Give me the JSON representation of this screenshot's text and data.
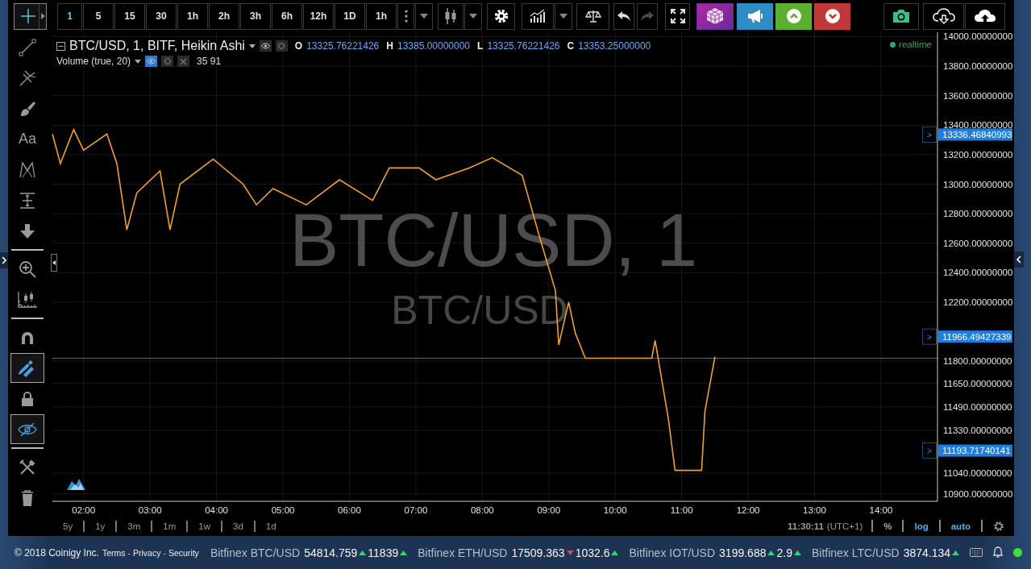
{
  "toolbar": {
    "crosshair": {
      "selected": true
    },
    "intervals": [
      {
        "label": "1",
        "selected": true
      },
      {
        "label": "5",
        "selected": false
      },
      {
        "label": "15",
        "selected": false
      },
      {
        "label": "30",
        "selected": false
      },
      {
        "label": "1h",
        "selected": false
      },
      {
        "label": "2h",
        "selected": false
      },
      {
        "label": "3h",
        "selected": false
      },
      {
        "label": "6h",
        "selected": false
      },
      {
        "label": "12h",
        "selected": false
      },
      {
        "label": "1D",
        "selected": false
      },
      {
        "label": "1h",
        "selected": false
      }
    ],
    "tools": [
      {
        "kind": "more",
        "disabled": false
      },
      {
        "kind": "caret",
        "disabled": false
      },
      {
        "kind": "candles",
        "disabled": false
      },
      {
        "kind": "caret",
        "disabled": false
      },
      {
        "kind": "settings",
        "disabled": false
      },
      {
        "kind": "indicators",
        "disabled": false
      },
      {
        "kind": "caret",
        "disabled": false
      },
      {
        "kind": "compare",
        "disabled": false
      },
      {
        "kind": "undo",
        "disabled": false
      },
      {
        "kind": "redo",
        "disabled": true
      },
      {
        "kind": "fullscreen",
        "disabled": false
      },
      {
        "kind": "cube",
        "disabled": false
      },
      {
        "kind": "announce",
        "disabled": false
      },
      {
        "kind": "buy",
        "disabled": false
      },
      {
        "kind": "sell",
        "disabled": false
      },
      {
        "kind": "snapshot",
        "disabled": false
      },
      {
        "kind": "load",
        "disabled": false
      },
      {
        "kind": "save",
        "disabled": false
      }
    ]
  },
  "sidebar": {
    "groups": [
      {
        "items": [
          {
            "kind": "line",
            "on": false
          },
          {
            "kind": "pitchfork",
            "on": false
          },
          {
            "kind": "brush",
            "on": false
          },
          {
            "kind": "text",
            "label": "Aa",
            "on": false
          },
          {
            "kind": "pattern",
            "on": false
          },
          {
            "kind": "measure",
            "on": false
          },
          {
            "kind": "arrow",
            "on": false
          }
        ]
      },
      {
        "items": [
          {
            "kind": "zoom",
            "on": false
          },
          {
            "kind": "ruler",
            "on": false
          }
        ]
      },
      {
        "items": [
          {
            "kind": "magnet",
            "on": false
          },
          {
            "kind": "stay-drawing",
            "on": true
          },
          {
            "kind": "lock",
            "on": false
          },
          {
            "kind": "hide",
            "on": true
          }
        ]
      },
      {
        "items": [
          {
            "kind": "tools",
            "on": false
          },
          {
            "kind": "trash",
            "on": false
          }
        ]
      }
    ]
  },
  "legend": {
    "rows": [
      {
        "kind": "series",
        "title": "BTC/USD, 1, BITF, Heikin Ashi",
        "eye_on": false,
        "values": [
          {
            "label": "O",
            "value": "13325.76221426"
          },
          {
            "label": "H",
            "value": "13385.00000000"
          },
          {
            "label": "L",
            "value": "13325.76221426"
          },
          {
            "label": "C",
            "value": "13353.25000000"
          }
        ]
      },
      {
        "kind": "indicator",
        "title": "Volume (true, 20)",
        "eye_on": true,
        "text": "35 91"
      }
    ],
    "realtime": {
      "label": "realtime",
      "live": true
    }
  },
  "chart": {
    "watermark": {
      "title": "BTC/USD, 1",
      "subtitle": "BTC/USD"
    },
    "price_badges": [
      {
        "marker": ">",
        "value": "13336.46840993"
      },
      {
        "marker": ">",
        "value": "11966.49427339"
      },
      {
        "marker": ">",
        "value": "11193.71740141"
      }
    ],
    "chart_data": {
      "type": "line",
      "xlim": [
        1.53,
        14.85
      ],
      "ylim": [
        10850,
        14030
      ],
      "x": [
        1.53,
        1.65,
        1.85,
        2.0,
        2.35,
        2.5,
        2.65,
        2.8,
        3.15,
        3.3,
        3.45,
        3.95,
        4.4,
        4.6,
        4.85,
        5.35,
        5.85,
        6.35,
        6.6,
        7.05,
        7.3,
        7.8,
        8.15,
        8.6,
        8.85,
        9.1,
        9.15,
        9.3,
        9.4,
        9.55,
        10.55,
        10.6,
        10.8,
        10.9,
        11.3,
        11.35,
        11.5
      ],
      "series": [
        {
          "color": "#f0a030",
          "values": [
            13340,
            13140,
            13370,
            13230,
            13340,
            13140,
            12690,
            12940,
            13090,
            12690,
            13000,
            13170,
            13000,
            12860,
            12970,
            12860,
            13030,
            12890,
            13110,
            13110,
            13030,
            13110,
            13180,
            13060,
            12660,
            12280,
            11910,
            12200,
            11990,
            11820,
            11820,
            11940,
            11410,
            11060,
            11060,
            11460,
            11830
          ]
        }
      ],
      "xticks": [
        {
          "value": 2,
          "label": "02:00"
        },
        {
          "value": 3,
          "label": "03:00"
        },
        {
          "value": 4,
          "label": "04:00"
        },
        {
          "value": 5,
          "label": "05:00"
        },
        {
          "value": 6,
          "label": "06:00"
        },
        {
          "value": 7,
          "label": "07:00"
        },
        {
          "value": 8,
          "label": "08:00"
        },
        {
          "value": 9,
          "label": "09:00"
        },
        {
          "value": 10,
          "label": "10:00"
        },
        {
          "value": 11,
          "label": "11:00"
        },
        {
          "value": 12,
          "label": "12:00"
        },
        {
          "value": 13,
          "label": "13:00"
        },
        {
          "value": 14,
          "label": "14:00"
        }
      ],
      "yticks": [
        {
          "value": 14000,
          "label": "14000.00000000"
        },
        {
          "value": 13800,
          "label": "13800.00000000"
        },
        {
          "value": 13600,
          "label": "13600.00000000"
        },
        {
          "value": 13400,
          "label": "13400.00000000"
        },
        {
          "value": 13200,
          "label": "13200.00000000"
        },
        {
          "value": 13000,
          "label": "13000.00000000"
        },
        {
          "value": 12800,
          "label": "12800.00000000"
        },
        {
          "value": 12600,
          "label": "12600.00000000"
        },
        {
          "value": 12400,
          "label": "12400.00000000"
        },
        {
          "value": 12200,
          "label": "12200.00000000"
        },
        {
          "value": 11800,
          "label": "11800.00000000"
        },
        {
          "value": 11650,
          "label": "11650.00000000"
        },
        {
          "value": 11490,
          "label": "11490.00000000"
        },
        {
          "value": 11330,
          "label": "11330.00000000"
        },
        {
          "value": 11040,
          "label": "11040.00000000"
        },
        {
          "value": 10900,
          "label": "10900.00000000"
        }
      ],
      "grid": true,
      "ref_lines": [
        {
          "value": 11820,
          "axis": "y"
        }
      ]
    }
  },
  "bottom_bar": {
    "ranges": [
      "5y",
      "1y",
      "3m",
      "1m",
      "1w",
      "3d",
      "1d"
    ],
    "time": "11:30:11",
    "timezone": "(UTC+1)",
    "options": [
      {
        "label": "%",
        "selected": false
      },
      {
        "label": "log",
        "selected": true
      },
      {
        "label": "auto",
        "selected": true
      }
    ]
  },
  "footer": {
    "copyright": "© 2018 Coinigy Inc.",
    "links": [
      {
        "kind": "link",
        "text": "Terms"
      },
      {
        "kind": "separator",
        "text": "-"
      },
      {
        "kind": "link",
        "text": "Privacy"
      },
      {
        "kind": "separator",
        "text": "-"
      },
      {
        "kind": "link",
        "text": "Security"
      }
    ],
    "ticker": [
      {
        "exchange": "Bitfinex",
        "pair": "BTC/USD",
        "price": "54814.759",
        "price_up": true,
        "volume": "11839",
        "volume_up": true
      },
      {
        "exchange": "Bitfinex",
        "pair": "ETH/USD",
        "price": "17509.363",
        "price_up": false,
        "volume": "1032.6",
        "volume_up": true
      },
      {
        "exchange": "Bitfinex",
        "pair": "IOT/USD",
        "price": "3199.688",
        "price_up": true,
        "volume": "2.9",
        "volume_up": true
      },
      {
        "exchange": "Bitfinex",
        "pair": "LTC/USD",
        "price": "3874.134",
        "price_up": true
      }
    ],
    "connected": true
  }
}
